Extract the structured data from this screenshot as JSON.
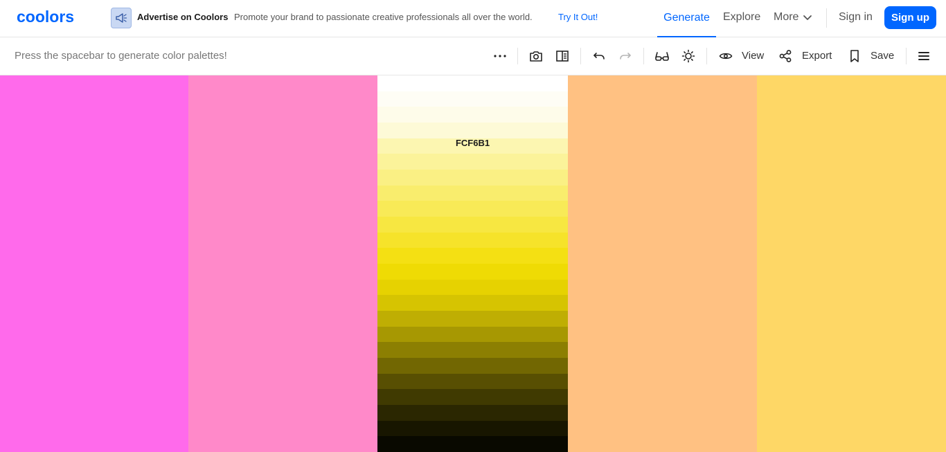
{
  "brand": {
    "name": "coolors",
    "color": "#0066ff"
  },
  "ad": {
    "icon": "megaphone-icon",
    "title": "Advertise on Coolors",
    "description": "Promote your brand to passionate creative professionals all over the world.",
    "link": "Try It Out!"
  },
  "nav": {
    "generate": "Generate",
    "explore": "Explore",
    "more": "More",
    "signin": "Sign in",
    "signup": "Sign up"
  },
  "toolbar": {
    "hint": "Press the spacebar to generate color palettes!",
    "view_label": "View",
    "export_label": "Export",
    "save_label": "Save",
    "icons": [
      "more-dots-icon",
      "camera-icon",
      "layout-icon",
      "undo-icon",
      "redo-icon",
      "glasses-icon",
      "sun-icon",
      "eye-icon",
      "share-icon",
      "bookmark-icon",
      "menu-icon"
    ]
  },
  "palette": {
    "colors": [
      {
        "hex": "#FF6AEB",
        "width": 272
      },
      {
        "hex": "#FF89C9",
        "width": 273
      },
      {
        "hex": "#FCF6B1",
        "width": 275,
        "label": "FCF6B1",
        "shades": [
          "#FFFFFF",
          "#FEFDF5",
          "#FEFCEA",
          "#FDFAD7",
          "#FCF6B1",
          "#FBF39A",
          "#FAF084",
          "#F9ED6D",
          "#F8EA57",
          "#F7E741",
          "#F6E32A",
          "#F4E013",
          "#EFDB04",
          "#E6D201",
          "#D6C401",
          "#BFAE03",
          "#A79802",
          "#8C7F02",
          "#726702",
          "#584F02",
          "#403A01",
          "#2B2701",
          "#181600",
          "#090900"
        ]
      },
      {
        "hex": "#FFC182",
        "width": 273
      },
      {
        "hex": "#FED766",
        "width": 273
      }
    ]
  }
}
